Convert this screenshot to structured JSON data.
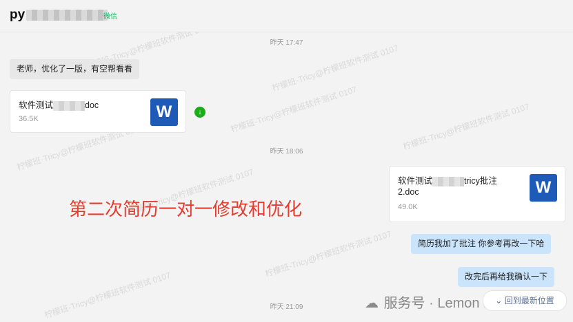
{
  "header": {
    "title_prefix": "py",
    "source_tag": "微信"
  },
  "times": [
    "昨天 17:47",
    "昨天 18:06",
    "昨天 21:09"
  ],
  "messages": {
    "m1": "老师，优化了一版，有空帮看看",
    "file1": {
      "name_prefix": "软件测试",
      "name_suffix": "doc",
      "size": "36.5K",
      "icon": "W"
    },
    "file2": {
      "name_line1_prefix": "软件测试",
      "name_line1_suffix": "tricy批注",
      "name_line2": "2.doc",
      "size": "49.0K",
      "icon": "W"
    },
    "m2": "简历我加了批注 你参考再改一下哈",
    "m3": "改完后再给我确认一下"
  },
  "overlay_text": "第二次简历一对一修改和优化",
  "watermark_text": "柠檬班-Tricy@柠檬班软件测试 0107",
  "footer": {
    "brand": "服务号 · Lemon  ffice",
    "back_button": "回到最新位置"
  },
  "icons": [
    "wechat-icon",
    "download-icon",
    "word-doc-icon",
    "chevron-down-icon"
  ],
  "colors": {
    "outgoing_bubble": "#c9e4fb",
    "incoming_bubble": "#e7e7e7",
    "overlay": "#e53c2e",
    "download": "#1aad19",
    "word": "#1e5bb8"
  }
}
